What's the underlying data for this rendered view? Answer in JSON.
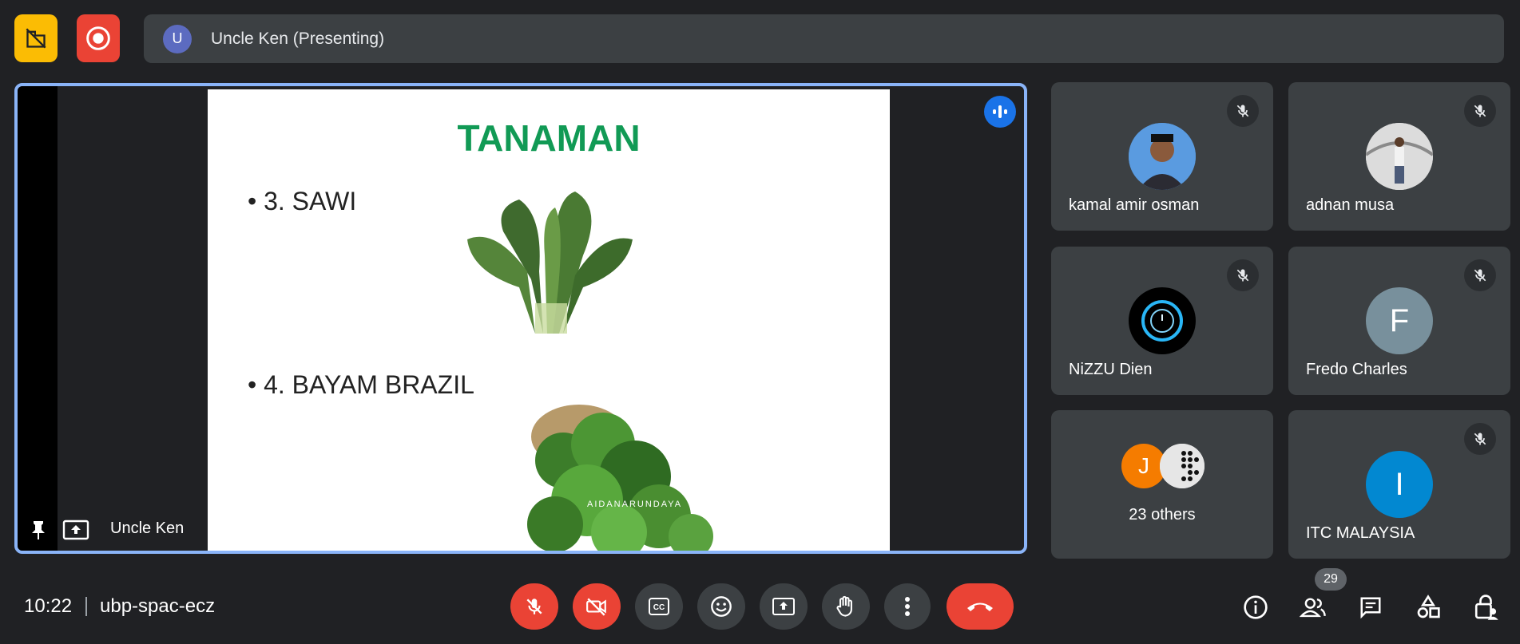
{
  "top": {
    "presenter_initial": "U",
    "presenter_banner": "Uncle Ken (Presenting)"
  },
  "stage": {
    "presenter_name": "Uncle Ken",
    "slide": {
      "title": "TANAMAN",
      "item1": "• 3. SAWI",
      "item2": "• 4. BAYAM BRAZIL",
      "watermark": "AIDANARUNDAYA"
    }
  },
  "participants": [
    {
      "name": "kamal amir osman"
    },
    {
      "name": "adnan musa"
    },
    {
      "name": "NiZZU Dien"
    },
    {
      "name": "Fredo Charles",
      "initial": "F"
    },
    {
      "name": "23 others",
      "initial": "J"
    },
    {
      "name": "ITC MALAYSIA",
      "initial": "I"
    }
  ],
  "bottom": {
    "time": "10:22",
    "meeting_code": "ubp-spac-ecz",
    "people_count": "29"
  },
  "colors": {
    "accent_blue": "#8ab4f8",
    "danger_red": "#ea4335",
    "warning_yellow": "#fbbc04",
    "tile_bg": "#3c4043"
  }
}
